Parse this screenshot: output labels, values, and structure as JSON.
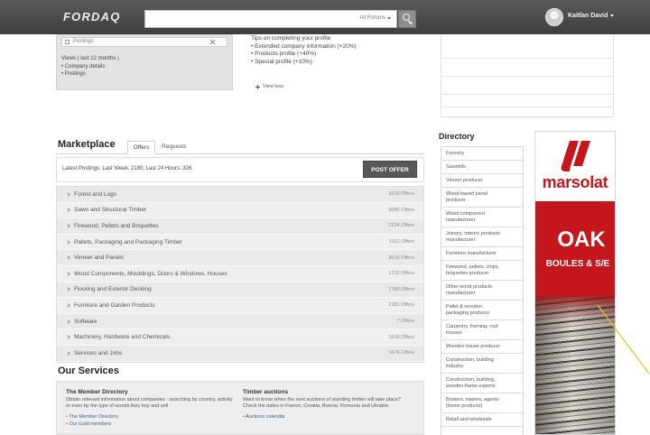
{
  "colors": {
    "header_bg": "#464646",
    "button_bg": "#575757",
    "ad_red": "#c4161c",
    "annotation_line": "#e8c31a"
  },
  "icons": {
    "search_button": "search-icon",
    "scope_dropdown": "chevron-down-icon",
    "user_menu": "chevron-down-icon",
    "category_bullet": "chevron-right-icon"
  },
  "header": {
    "logo": "FORDAQ",
    "search": {
      "scope": "All Forums"
    },
    "user": {
      "name": "Kaitlan David"
    }
  },
  "profile": {
    "postings_field": "Postings",
    "views": {
      "title": "Views ( last 12 months )",
      "items": [
        "Company details",
        "Postings"
      ]
    },
    "tips": {
      "title": "Tips on completing your profile",
      "items": [
        "Extended company information (+20%)",
        "Products profile (+40%)",
        "Special profile (+10%)"
      ]
    },
    "view_less": "View less"
  },
  "marketplace": {
    "title": "Marketplace",
    "tabs": [
      {
        "label": "Offers",
        "active": true
      },
      {
        "label": "Requests",
        "active": false
      }
    ],
    "latest": "Latest Postings: Last Week: 2180; Last 24 Hours: 326",
    "post_button": "POST OFFER",
    "categories": [
      {
        "name": "Forest and Logs",
        "count": "1516 Offers"
      },
      {
        "name": "Sawn and Structural Timber",
        "count": "3085 Offers"
      },
      {
        "name": "Firewood, Pellets and Briquettes",
        "count": "2224 Offers"
      },
      {
        "name": "Pallets, Packaging and Packaging Timber",
        "count": "1011 Offers"
      },
      {
        "name": "Veneer and Panels",
        "count": "3615 Offers"
      },
      {
        "name": "Wood Components, Mouldings, Doors & Windows, Houses",
        "count": "1710 Offers"
      },
      {
        "name": "Flooring and Exterior Decking",
        "count": "1780 Offers"
      },
      {
        "name": "Furniture and Garden Products",
        "count": "2381 Offers"
      },
      {
        "name": "Software",
        "count": "7 Offers"
      },
      {
        "name": "Machinery, Hardware and Chemicals",
        "count": "1016 Offers"
      },
      {
        "name": "Services and Jobs",
        "count": "1674 Offers"
      }
    ]
  },
  "services": {
    "title": "Our Services",
    "member_directory": {
      "title": "The Member Directory",
      "text": "Obtain relevant information about companies - searching by country, activity or even by the type of woods they buy and sell",
      "links": [
        "The Member Directory",
        "Our Gold members"
      ]
    },
    "timber_auctions": {
      "title": "Timber auctions",
      "text": "Want to know when the next auctions of standing timber will take place? Check the dates in France, Croatia, Bosnia, Romania and Ukraine.",
      "links": [
        "Auctions calendar"
      ]
    }
  },
  "directory": {
    "title": "Directory",
    "items": [
      "Forestry",
      "Sawmills",
      "Veneer producer",
      "Wood-based panel producer",
      "Wood component manufacturer",
      "Joinery, interior products manufacturer",
      "Furniture manufacturer",
      "Firewood, pellets, chips, briquettes producer",
      "Other wood products manufacturer",
      "Pallet & wooden packaging producer",
      "Carpentry, framing, roof trusses",
      "Wooden house producer",
      "Construction, building industry",
      "Construction, building, wooden frame experts",
      "Brokers, traders, agents (forest products)",
      "Retail and wholesale"
    ]
  },
  "ad": {
    "brand": "marsolat",
    "headline": "OAK",
    "subline": "BOULES & S/E"
  }
}
